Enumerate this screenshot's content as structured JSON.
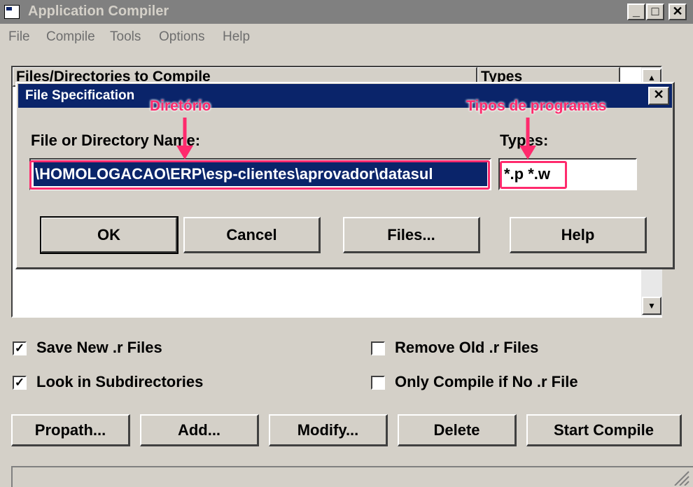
{
  "window": {
    "title": "Application Compiler",
    "controls": {
      "minimize": "_",
      "maximize": "□",
      "close": "✕"
    }
  },
  "menu": [
    "File",
    "Compile",
    "Tools",
    "Options",
    "Help"
  ],
  "list": {
    "col_files": "Files/Directories to Compile",
    "col_types": "Types",
    "scroll_up": "▲",
    "scroll_down": "▼"
  },
  "dialog": {
    "title": "File Specification",
    "close": "✕",
    "name_label": "File or Directory Name:",
    "name_value": "\\HOMOLOGACAO\\ERP\\esp-clientes\\aprovador\\datasul",
    "types_label": "Types:",
    "types_value": "*.p *.w",
    "buttons": {
      "ok": "OK",
      "cancel": "Cancel",
      "files": "Files...",
      "help": "Help"
    }
  },
  "annotations": {
    "dir": "Diretório",
    "types": "Tipos de programas",
    "color": "#ff2a6d"
  },
  "options": {
    "save_new": {
      "label": "Save New .r Files",
      "checked": "✓"
    },
    "look_sub": {
      "label": "Look in Subdirectories",
      "checked": "✓"
    },
    "remove_old": {
      "label": "Remove Old .r Files",
      "checked": ""
    },
    "only_compile": {
      "label": "Only Compile if No .r File",
      "checked": ""
    }
  },
  "buttons": {
    "propath": "Propath...",
    "add": "Add...",
    "modify": "Modify...",
    "delete": "Delete",
    "start": "Start Compile"
  },
  "colors": {
    "title_active": "#0a246a",
    "title_inactive": "#808080",
    "face": "#d4d0c8"
  }
}
